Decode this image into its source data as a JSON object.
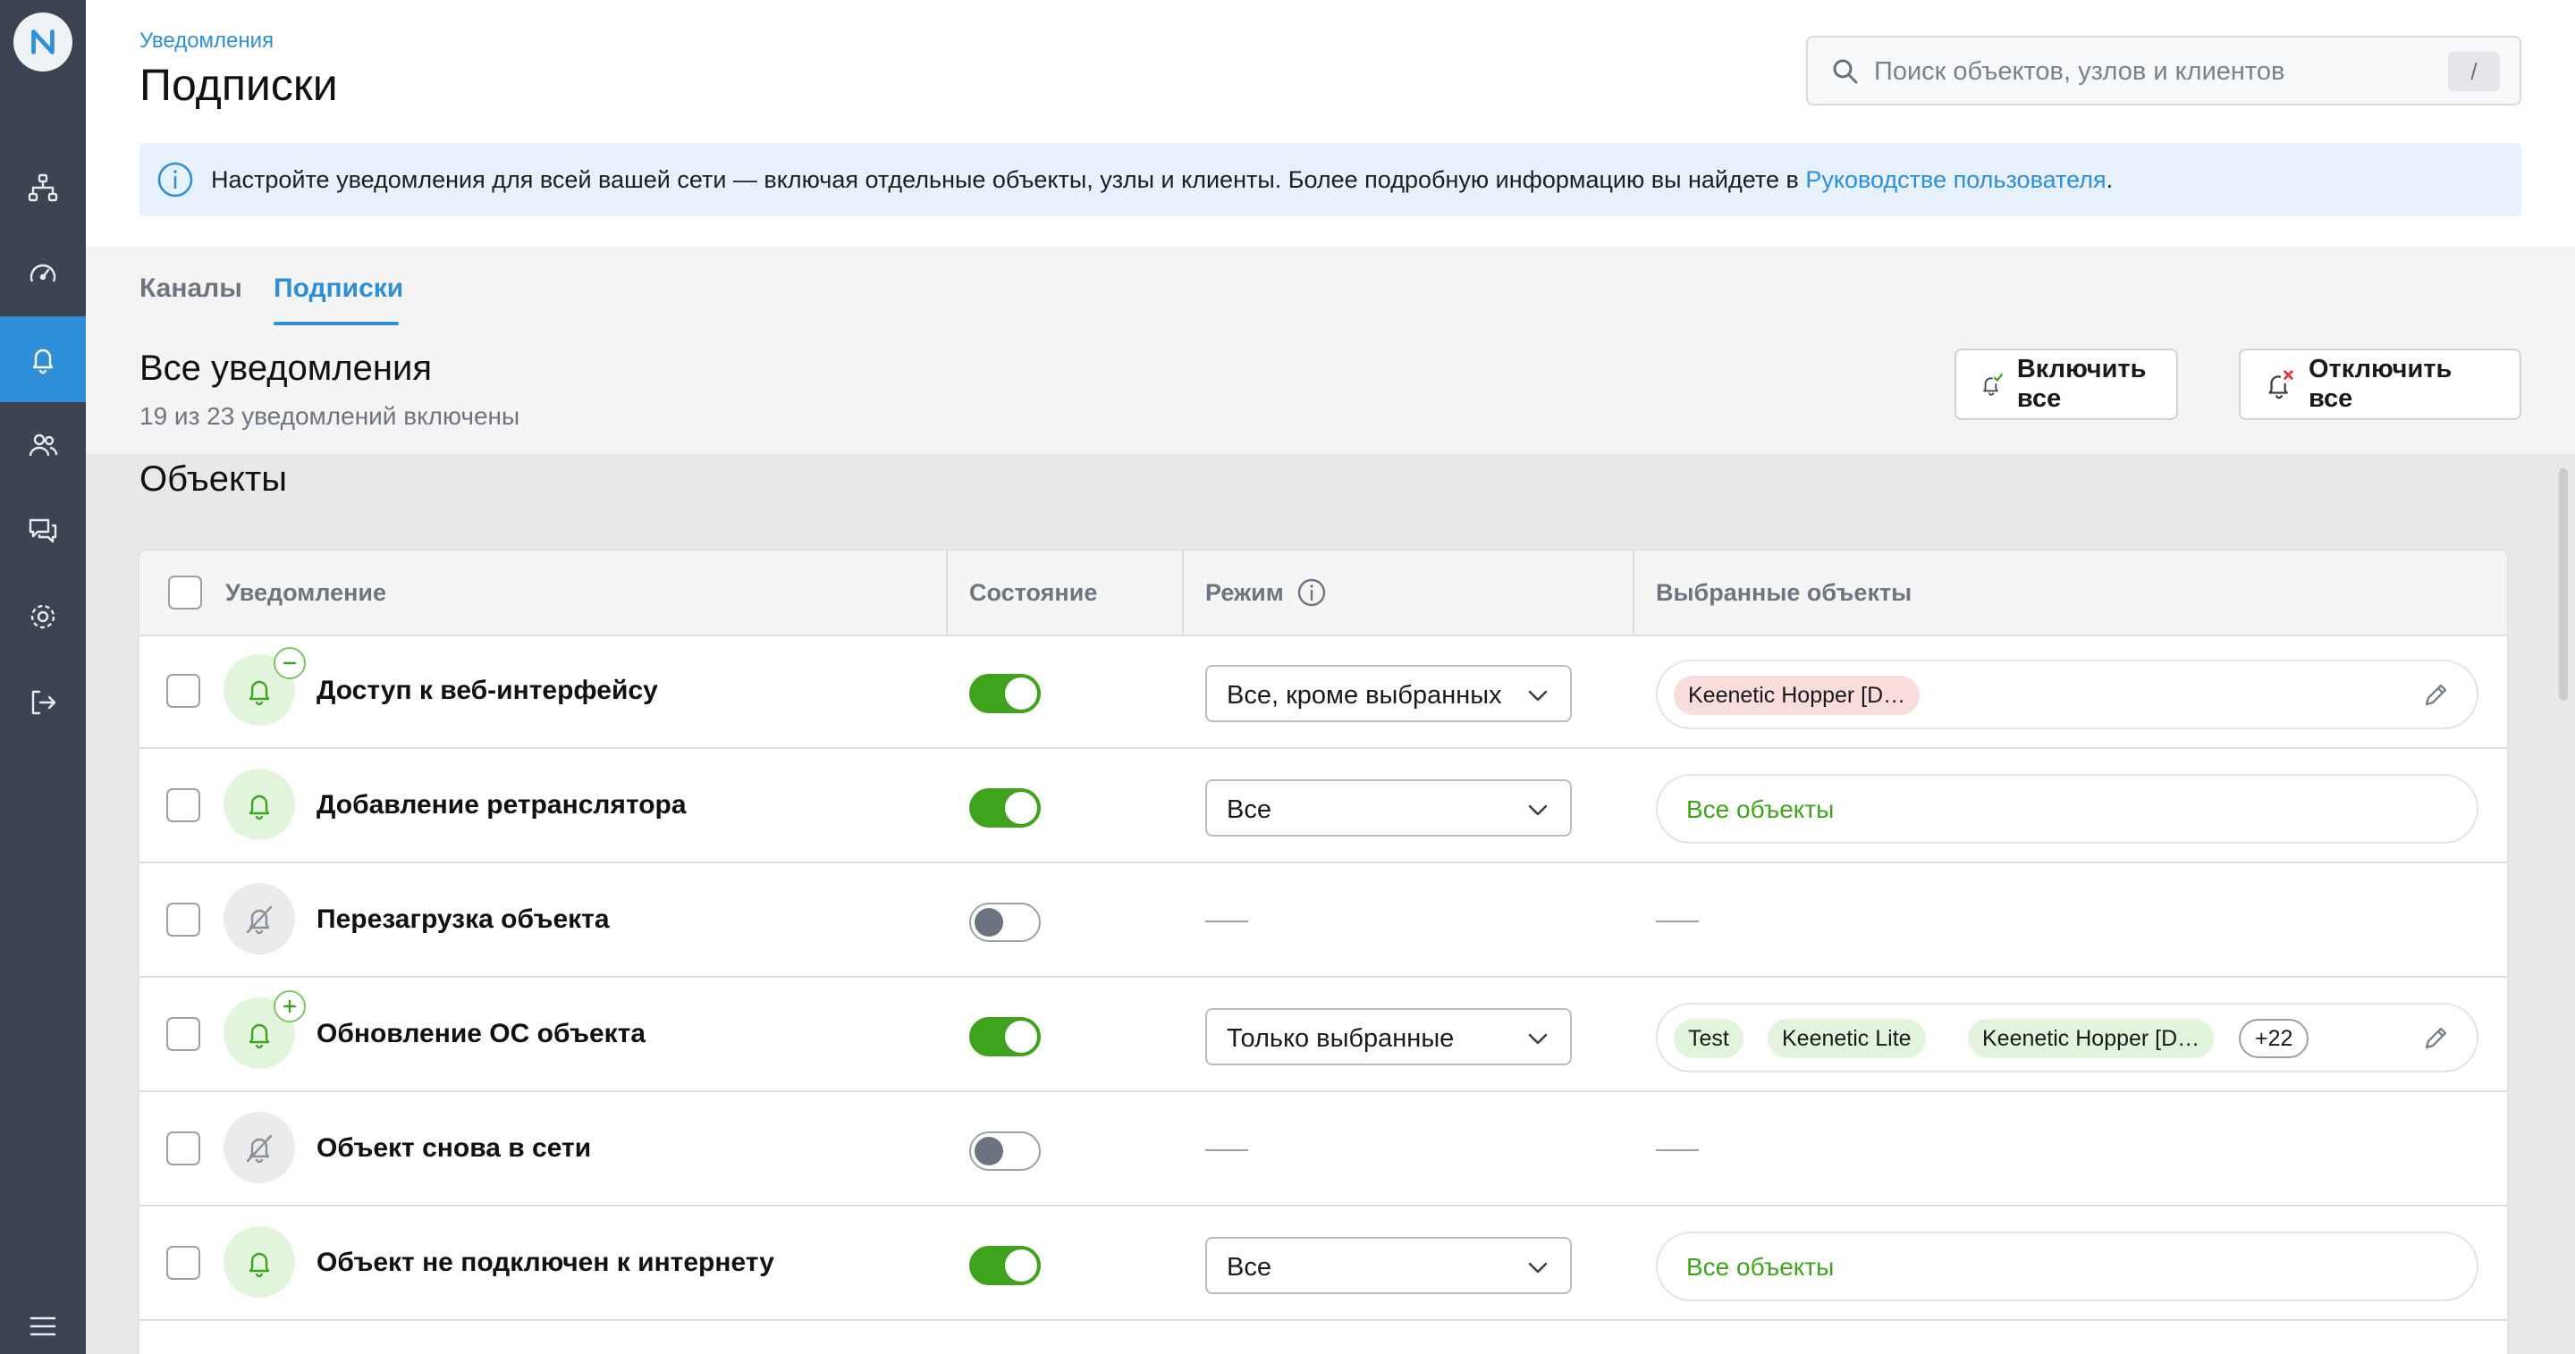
{
  "sidebar": {
    "logo_letter": "N",
    "items": [
      {
        "icon": "network-topology-icon",
        "label": ""
      },
      {
        "icon": "speedometer-icon",
        "label": ""
      },
      {
        "icon": "bell-icon",
        "label": "",
        "active": true
      },
      {
        "icon": "users-icon",
        "label": ""
      },
      {
        "icon": "chat-icon",
        "label": ""
      },
      {
        "icon": "gear-icon",
        "label": ""
      },
      {
        "icon": "logout-icon",
        "label": ""
      },
      {
        "icon": "hamburger-menu-icon",
        "label": ""
      }
    ]
  },
  "header": {
    "breadcrumb": "Уведомления",
    "title": "Подписки",
    "search": {
      "placeholder": "Поиск объектов, узлов и клиентов",
      "shortcut": "/"
    }
  },
  "info_banner": {
    "text": "Настройте уведомления для всей вашей сети — включая отдельные объекты, узлы и клиенты. Более подробную информацию вы найдете в ",
    "link": "Руководстве пользователя",
    "suffix": "."
  },
  "tabs": [
    {
      "label": "Каналы",
      "active": false
    },
    {
      "label": "Подписки",
      "active": true
    }
  ],
  "section": {
    "title": "Все уведомления",
    "subtitle": "19 из 23 уведомлений включены",
    "enable_all": "Включить все",
    "disable_all": "Отключить все"
  },
  "group": {
    "title": "Объекты"
  },
  "table": {
    "headers": {
      "notification": "Уведомление",
      "state": "Состояние",
      "mode": "Режим",
      "objects": "Выбранные объекты"
    },
    "rows": [
      {
        "name": "Доступ к веб-интерфейсу",
        "enabled": true,
        "badge": "minus",
        "mode": "Все, кроме выбранных",
        "objects_all": "",
        "chips": [
          {
            "text": "Keenetic Hopper [D…",
            "kind": "red"
          }
        ],
        "editable": true
      },
      {
        "name": "Добавление ретранслятора",
        "enabled": true,
        "badge": "",
        "mode": "Все",
        "objects_all": "Все объекты",
        "chips": [],
        "editable": false
      },
      {
        "name": "Перезагрузка объекта",
        "enabled": false,
        "badge": "",
        "mode": "",
        "objects_all": "",
        "chips": [],
        "editable": false
      },
      {
        "name": "Обновление ОС объекта",
        "enabled": true,
        "badge": "plus",
        "mode": "Только выбранные",
        "objects_all": "",
        "chips": [
          {
            "text": "Test",
            "kind": "green"
          },
          {
            "text": "Keenetic Lite",
            "kind": "green"
          },
          {
            "text": "Keenetic Hopper [D…",
            "kind": "green"
          },
          {
            "text": "+22",
            "kind": "count"
          }
        ],
        "editable": true
      },
      {
        "name": "Объект снова в сети",
        "enabled": false,
        "badge": "",
        "mode": "",
        "objects_all": "",
        "chips": [],
        "editable": false
      },
      {
        "name": "Объект не подключен к интернету",
        "enabled": true,
        "badge": "",
        "mode": "Все",
        "objects_all": "Все объекты",
        "chips": [],
        "editable": false
      }
    ]
  },
  "colors": {
    "accent": "#2f8ed8",
    "sidebar": "#3d4451",
    "toggle_on": "#3fa31d",
    "chip_red": "#f9dcdc",
    "chip_green": "#e2f5dc"
  }
}
